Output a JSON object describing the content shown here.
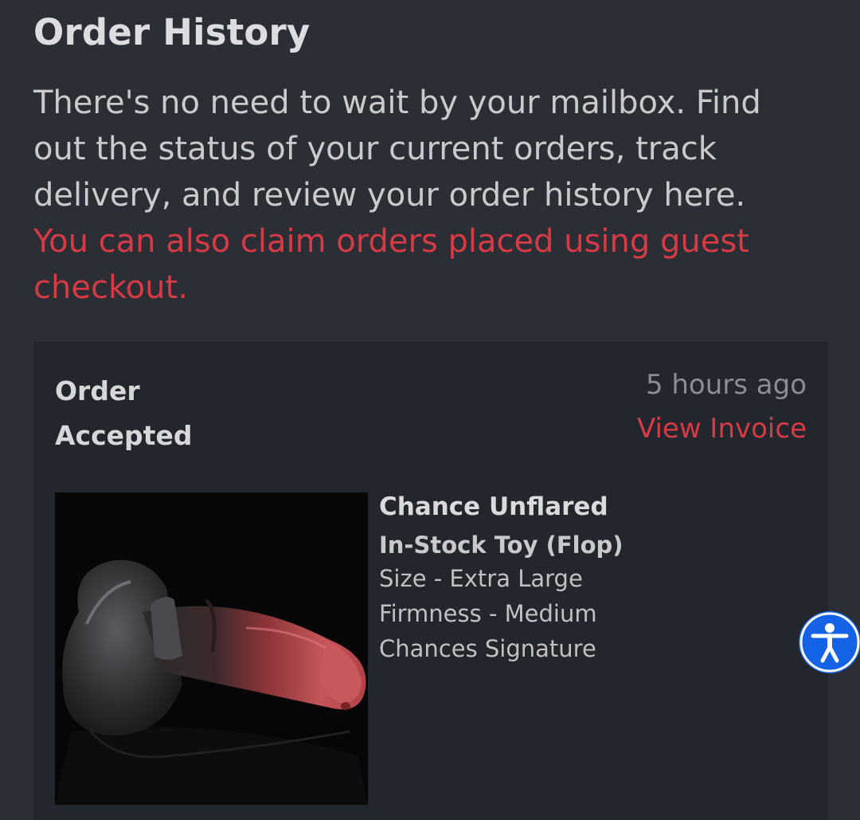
{
  "page": {
    "title": "Order History",
    "intro_lines": [
      "There's no need to wait by your mailbox. Find",
      "out the status of your current orders, track",
      "delivery, and review your order history here."
    ],
    "claim_link_lines": [
      "You can also claim orders placed using guest",
      "checkout."
    ]
  },
  "order": {
    "status_lines": [
      "Order",
      "Accepted"
    ],
    "time": "5 hours ago",
    "invoice_label": "View Invoice",
    "product": {
      "name": "Chance Unflared",
      "variant": "In-Stock Toy (Flop)",
      "options": [
        "Size - Extra Large",
        "Firmness - Medium",
        "Chances Signature"
      ]
    }
  },
  "colors": {
    "background": "#2b2e35",
    "card": "#23262d",
    "accent": "#d63a45",
    "accessibility_button": "#1463e6"
  },
  "icons": {
    "accessibility": "accessibility-person-icon"
  }
}
